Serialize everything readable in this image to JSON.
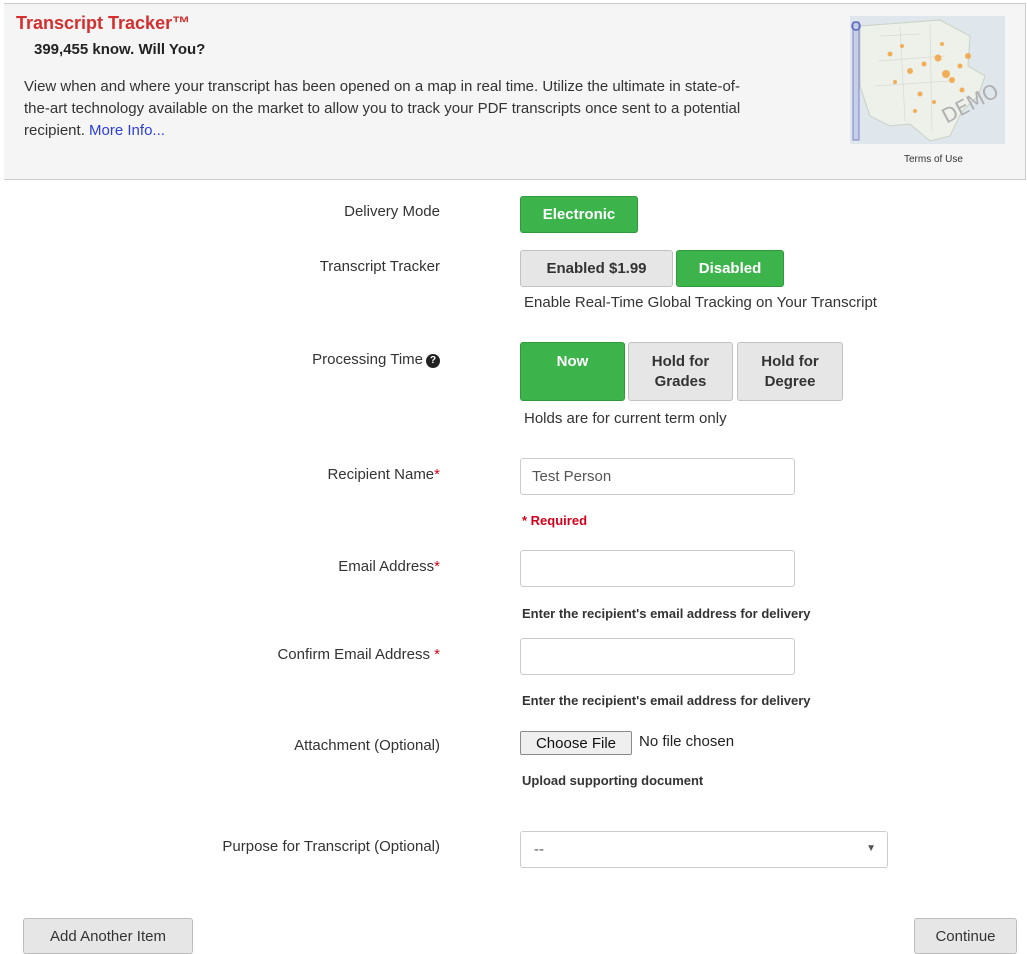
{
  "promo": {
    "title": "Transcript Tracker™",
    "subtitle": "399,455 know. Will You?",
    "description": "View when and where your transcript has been opened on a map in real time. Utilize the ultimate in state-of-the-art technology available on the market to allow you to track your PDF transcripts once sent to a potential recipient.",
    "more_info": "More Info...",
    "map_watermark": "DEMO",
    "terms": "Terms of Use"
  },
  "delivery": {
    "label": "Delivery Mode",
    "option": "Electronic"
  },
  "tracker": {
    "label": "Transcript Tracker",
    "enabled": "Enabled $1.99",
    "disabled": "Disabled",
    "selected": "Disabled",
    "note": "Enable Real-Time Global Tracking on Your Transcript"
  },
  "processing": {
    "label": "Processing Time",
    "help_icon": "question-circle-icon",
    "now": "Now",
    "hold_grades_1": "Hold for",
    "hold_grades_2": "Grades",
    "hold_degree_1": "Hold for",
    "hold_degree_2": "Degree",
    "selected": "Now",
    "note": "Holds are for current term only"
  },
  "recipient": {
    "label": "Recipient Name",
    "required_mark": "*",
    "value": "Test Person",
    "required_msg": "* Required"
  },
  "email": {
    "label": "Email Address",
    "required_mark": "*",
    "value": "",
    "hint": "Enter the recipient's email address for delivery"
  },
  "confirm_email": {
    "label": "Confirm Email Address ",
    "required_mark": "*",
    "value": "",
    "hint": "Enter the recipient's email address for delivery"
  },
  "attachment": {
    "label": "Attachment (Optional)",
    "button": "Choose File",
    "status": "No file chosen",
    "hint": "Upload supporting document"
  },
  "purpose": {
    "label": "Purpose for Transcript (Optional)",
    "selected": "--"
  },
  "actions": {
    "add_another": "Add Another Item",
    "continue": "Continue"
  },
  "colors": {
    "accent_green": "#3cb44b",
    "title_red": "#d32f2f",
    "required_red": "#d0021b",
    "link_blue": "#2a3fd9"
  }
}
